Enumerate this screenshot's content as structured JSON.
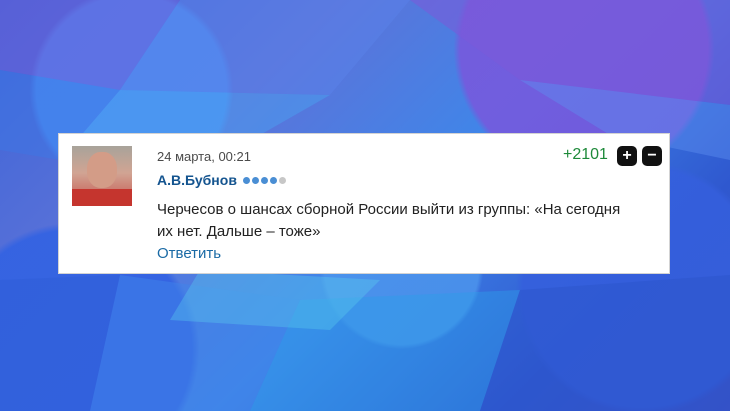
{
  "comment": {
    "date": "24 марта, 00:21",
    "author": "А.В.Бубнов",
    "rating_dots": 5,
    "rating_filled": 4,
    "text": "Черчесов о шансах сборной России выйти из группы: «На сегодня их нет. Дальше – тоже»",
    "reply_label": "Ответить",
    "score": "+2101"
  },
  "colors": {
    "author": "#14548f",
    "score": "#1e8a3a",
    "reply": "#1a6aa5"
  }
}
